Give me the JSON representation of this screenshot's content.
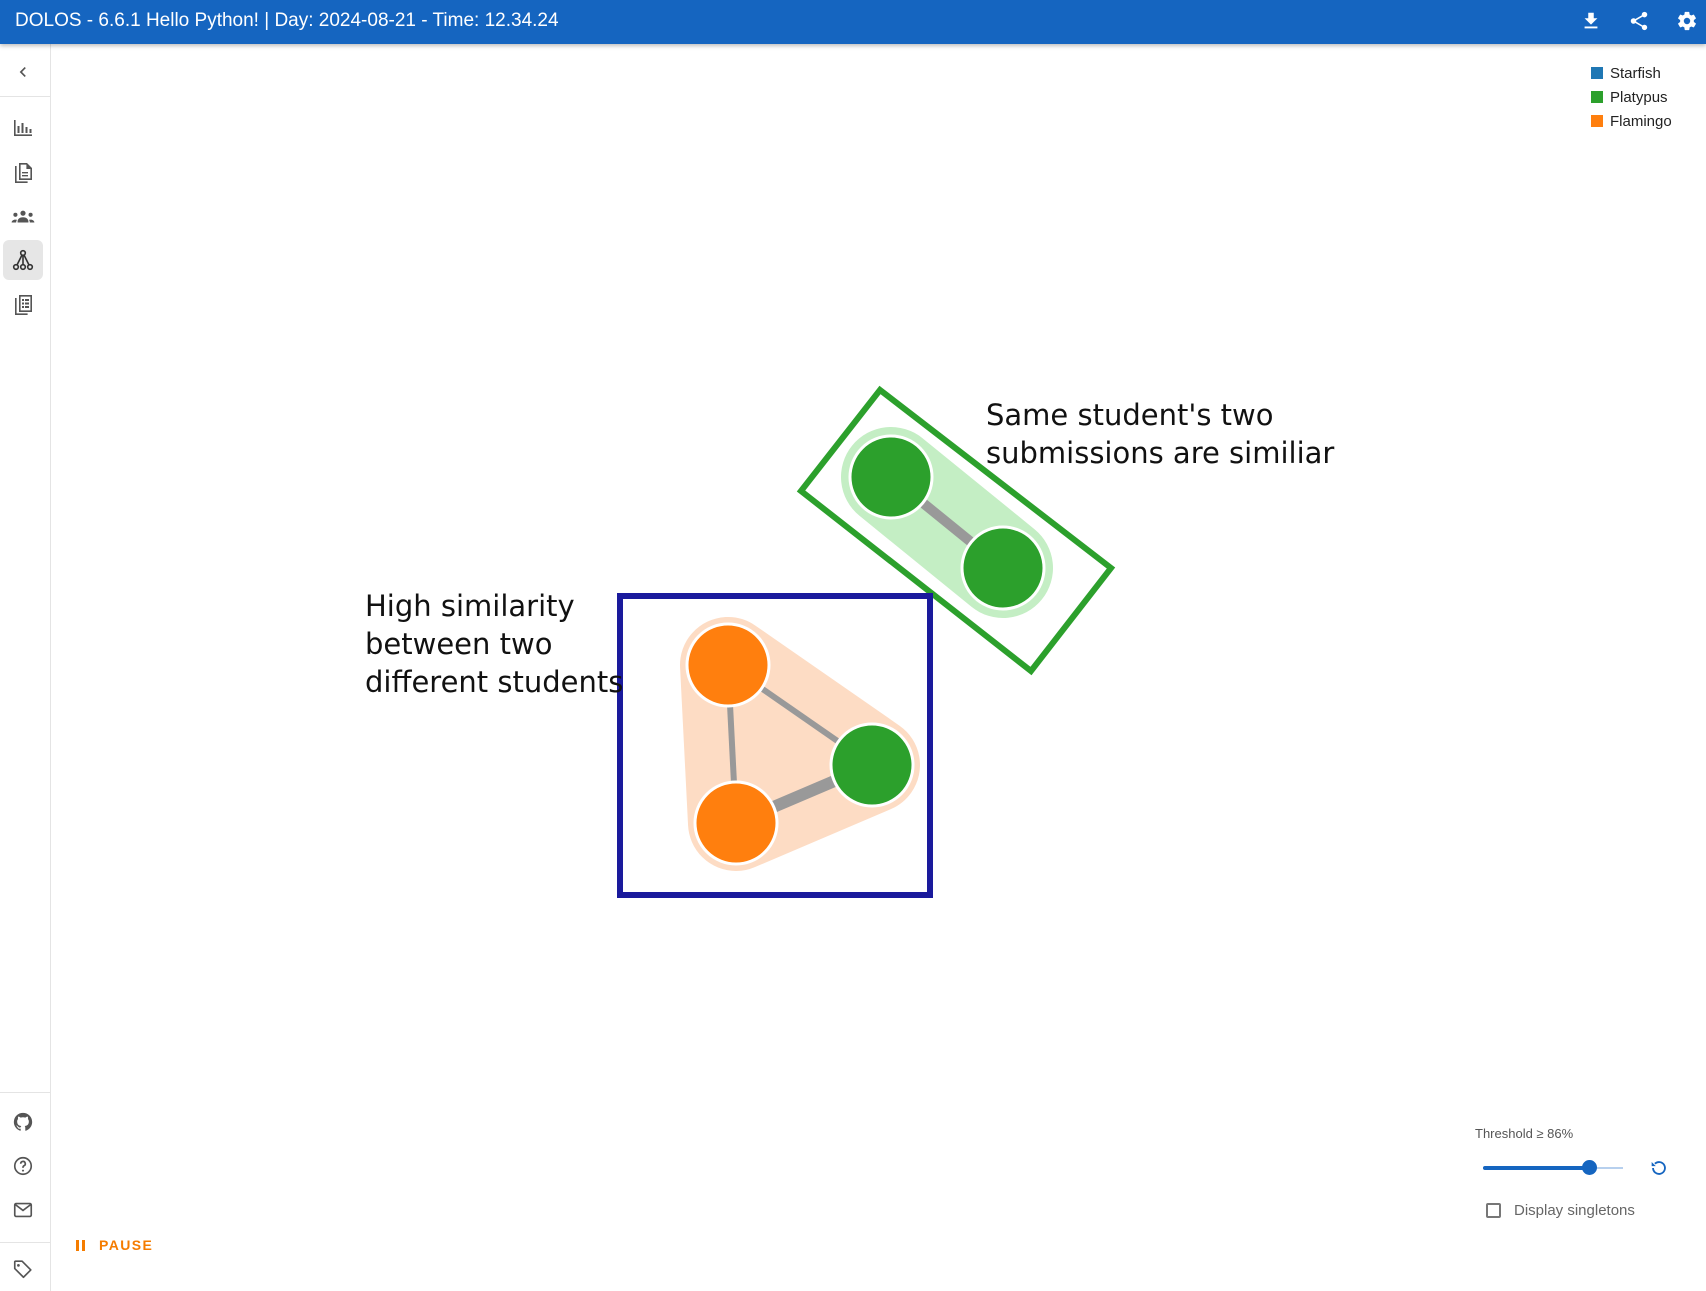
{
  "header": {
    "title": "DOLOS - 6.6.1 Hello Python! | Day: 2024-08-21 - Time: 12.34.24"
  },
  "sidebar": {
    "items": [
      {
        "name": "collapse",
        "icon": "chevron-left-icon"
      },
      {
        "name": "analysis",
        "icon": "bar-chart-icon"
      },
      {
        "name": "submissions",
        "icon": "file-document-icon"
      },
      {
        "name": "clusters",
        "icon": "account-group-icon"
      },
      {
        "name": "graph",
        "icon": "graph-icon",
        "active": true
      },
      {
        "name": "pairs",
        "icon": "file-table-icon"
      }
    ],
    "bottom_items": [
      {
        "name": "github",
        "icon": "github-icon"
      },
      {
        "name": "help",
        "icon": "help-circle-icon"
      },
      {
        "name": "contact",
        "icon": "email-icon"
      },
      {
        "name": "version",
        "icon": "tag-icon"
      }
    ]
  },
  "legend": {
    "items": [
      {
        "label": "Starfish",
        "color": "#1f77b4"
      },
      {
        "label": "Platypus",
        "color": "#2ca02c"
      },
      {
        "label": "Flamingo",
        "color": "#ff7f0e"
      }
    ]
  },
  "graph": {
    "node_colors": {
      "platypus": "#2ca02c",
      "flamingo": "#ff7f0e"
    },
    "highlight_colors": {
      "green_box": "#2ca02c",
      "blue_box": "#1a1a9c"
    }
  },
  "annotations": {
    "same_student": [
      "Same student's two",
      "submissions are similiar"
    ],
    "different_students": [
      "High similarity",
      "between two",
      "different students"
    ]
  },
  "controls": {
    "threshold_label": "Threshold ≥ 86%",
    "threshold_value": 0.76,
    "singletons_label": "Display singletons",
    "singletons_checked": false,
    "pause_label": "PAUSE"
  }
}
